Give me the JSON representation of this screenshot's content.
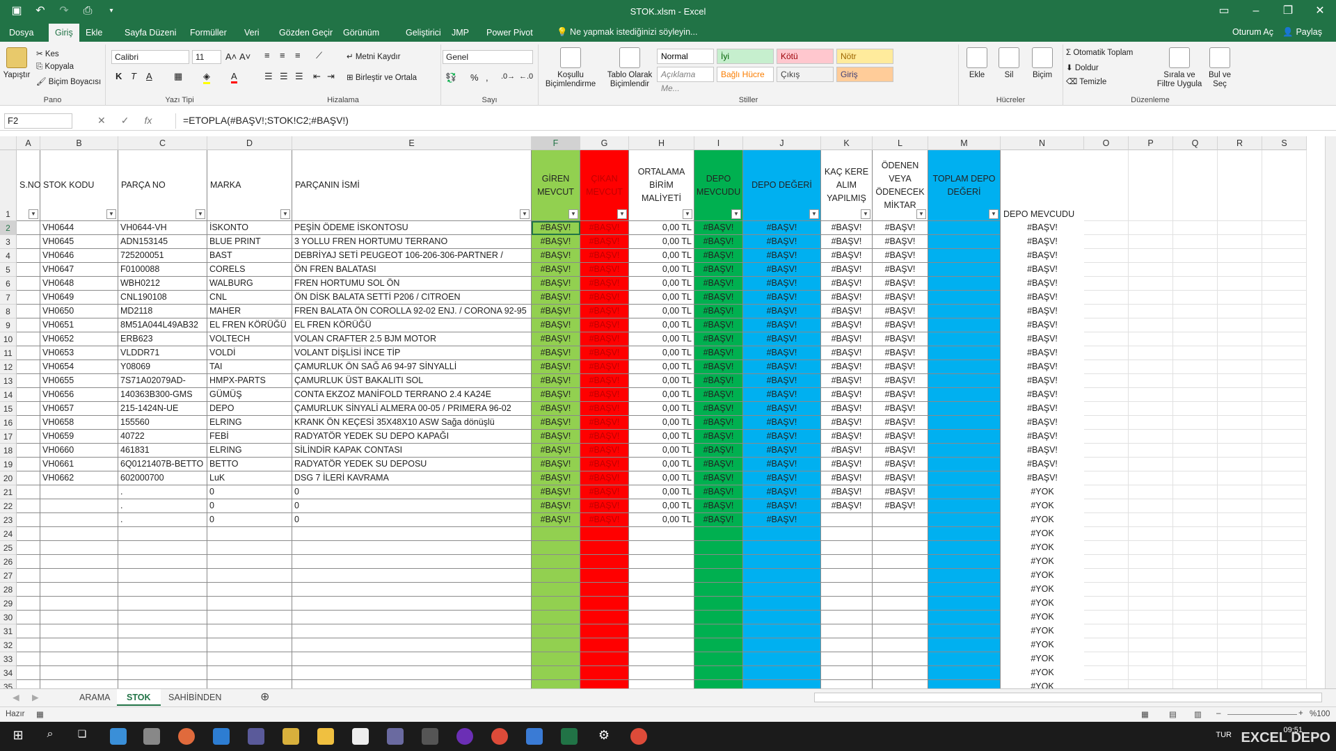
{
  "window": {
    "title": "STOK.xlsm - Excel"
  },
  "ribbon_tabs": [
    "Dosya",
    "Giriş",
    "Ekle",
    "Sayfa Düzeni",
    "Formüller",
    "Veri",
    "Gözden Geçir",
    "Görünüm",
    "Geliştirici",
    "JMP",
    "Power Pivot"
  ],
  "active_tab": "Giriş",
  "tell_me": "Ne yapmak istediğinizi söyleyin...",
  "account": {
    "signin": "Oturum Aç",
    "share": "Paylaş"
  },
  "ribbon": {
    "pano": {
      "paste": "Yapıştır",
      "cut": "Kes",
      "copy": "Kopyala",
      "format_painter": "Biçim Boyacısı",
      "label": "Pano"
    },
    "font": {
      "name": "Calibri",
      "size": "11",
      "label": "Yazı Tipi",
      "bold": "K",
      "italic": "T",
      "underline": "A"
    },
    "align": {
      "wrap": "Metni Kaydır",
      "merge": "Birleştir ve Ortala",
      "label": "Hizalama"
    },
    "number": {
      "format": "Genel",
      "percent": "%",
      "label": "Sayı"
    },
    "styles": {
      "cond": "Koşullu Biçimlendirme",
      "table": "Tablo Olarak Biçimlendir",
      "cells": [
        {
          "text": "Normal",
          "bg": "#ffffff",
          "fg": "#000000"
        },
        {
          "text": "İyi",
          "bg": "#c6efce",
          "fg": "#006100"
        },
        {
          "text": "Kötü",
          "bg": "#ffc7ce",
          "fg": "#9c0006"
        },
        {
          "text": "Nötr",
          "bg": "#ffeb9c",
          "fg": "#9c6500"
        },
        {
          "text": "Açıklama Me...",
          "bg": "#ffffff",
          "fg": "#7f7f7f"
        },
        {
          "text": "Bağlı Hücre",
          "bg": "#ffffff",
          "fg": "#fa7d00"
        },
        {
          "text": "Çıkış",
          "bg": "#f2f2f2",
          "fg": "#3f3f3f"
        },
        {
          "text": "Giriş",
          "bg": "#ffcc99",
          "fg": "#3f3f76"
        }
      ],
      "label": "Stiller"
    },
    "cells_grp": {
      "insert": "Ekle",
      "delete": "Sil",
      "format": "Biçim",
      "label": "Hücreler"
    },
    "edit": {
      "autosum": "Otomatik Toplam",
      "fill": "Doldur",
      "clear": "Temizle",
      "sort": "Sırala ve Filtre Uygula",
      "find": "Bul ve Seç",
      "label": "Düzenleme"
    }
  },
  "formula_bar": {
    "name_box": "F2",
    "formula": "=ETOPLA(#BAŞV!;STOK!C2;#BAŞV!)",
    "fx": "fx"
  },
  "columns": [
    "A",
    "B",
    "C",
    "D",
    "E",
    "F",
    "G",
    "H",
    "I",
    "J",
    "K",
    "L",
    "M",
    "N",
    "O",
    "P",
    "Q",
    "R",
    "S"
  ],
  "headers": {
    "A": "S.NO",
    "B": "STOK KODU",
    "C": "PARÇA NO",
    "D": "MARKA",
    "E": "PARÇANIN İSMİ",
    "F": "GİREN MEVCUT",
    "G": "ÇIKAN MEVCUT",
    "H": "ORTALAMA BİRİM MALİYETİ",
    "I": "DEPO MEVCUDU",
    "J": "DEPO DEĞERİ",
    "K": "KAÇ KERE ALIM YAPILMIŞ",
    "L": "ÖDENEN VEYA ÖDENECEK MİKTAR",
    "M": "TOPLAM DEPO DEĞERİ",
    "N": "DEPO MEVCUDU"
  },
  "colors": {
    "F": "#92d050",
    "G": "#ff0000",
    "I": "#00b050",
    "J": "#00b0f0",
    "M": "#00b0f0",
    "accent": "#217346"
  },
  "rows": [
    {
      "b": "VH0644",
      "c": "VH0644-VH",
      "d": "İSKONTO",
      "e": "PEŞİN ÖDEME İSKONTOSU"
    },
    {
      "b": "VH0645",
      "c": "ADN153145",
      "d": "BLUE PRINT",
      "e": "3 YOLLU FREN HORTUMU TERRANO"
    },
    {
      "b": "VH0646",
      "c": "725200051",
      "d": "BAST",
      "e": "DEBRİYAJ SETİ PEUGEOT 106-206-306-PARTNER /"
    },
    {
      "b": "VH0647",
      "c": "F0100088",
      "d": "CORELS",
      "e": "ÖN FREN BALATASI"
    },
    {
      "b": "VH0648",
      "c": "WBH0212",
      "d": "WALBURG",
      "e": "FREN HORTUMU SOL ÖN"
    },
    {
      "b": "VH0649",
      "c": "CNL190108",
      "d": "CNL",
      "e": "ÖN DİSK BALATA SETTİ P206 / CITROEN"
    },
    {
      "b": "VH0650",
      "c": "MD2118",
      "d": "MAHER",
      "e": "FREN BALATA ÖN COROLLA 92-02 ENJ. / CORONA 92-95"
    },
    {
      "b": "VH0651",
      "c": "8M51A044L49AB32",
      "d": "EL FREN KÖRÜĞÜ",
      "e": "EL FREN KÖRÜĞÜ"
    },
    {
      "b": "VH0652",
      "c": "ERB623",
      "d": "VOLTECH",
      "e": "VOLAN CRAFTER 2.5 BJM MOTOR"
    },
    {
      "b": "VH0653",
      "c": "VLDDR71",
      "d": "VOLDİ",
      "e": "VOLANT DİŞLİSİ İNCE TİP"
    },
    {
      "b": "VH0654",
      "c": "Y08069",
      "d": "TAI",
      "e": "ÇAMURLUK ÖN SAĞ A6 94-97 SİNYALLİ"
    },
    {
      "b": "VH0655",
      "c": "7S71A02079AD-",
      "d": "HMPX-PARTS",
      "e": "ÇAMURLUK ÜST BAKALITI SOL"
    },
    {
      "b": "VH0656",
      "c": "140363B300-GMS",
      "d": "GÜMÜŞ",
      "e": "CONTA EKZOZ MANİFOLD  TERRANO 2.4 KA24E"
    },
    {
      "b": "VH0657",
      "c": "215-1424N-UE",
      "d": "DEPO",
      "e": "ÇAMURLUK SİNYALİ ALMERA 00-05 / PRIMERA 96-02"
    },
    {
      "b": "VH0658",
      "c": "155560",
      "d": "ELRING",
      "e": "KRANK ÖN KEÇESİ 35X48X10 ASW Sağa dönüşlü"
    },
    {
      "b": "VH0659",
      "c": "40722",
      "d": "FEBİ",
      "e": "RADYATÖR YEDEK SU DEPO KAPAĞI"
    },
    {
      "b": "VH0660",
      "c": "461831",
      "d": "ELRING",
      "e": "SİLİNDİR KAPAK CONTASI"
    },
    {
      "b": "VH0661",
      "c": "6Q0121407B-BETTO",
      "d": "BETTO",
      "e": "RADYATÖR YEDEK SU DEPOSU"
    },
    {
      "b": "VH0662",
      "c": "602000700",
      "d": "LuK",
      "e": "DSG 7 İLERİ KAVRAMA"
    },
    {
      "b": "",
      "c": ".",
      "d": "0",
      "e": "0"
    },
    {
      "b": "",
      "c": ".",
      "d": "0",
      "e": "0"
    },
    {
      "b": "",
      "c": ".",
      "d": "0",
      "e": "0"
    }
  ],
  "error_value": "#BAŞV!",
  "cost_value": "0,00 TL",
  "na_value": "#YOK",
  "row_numbers": [
    "1",
    "2",
    "3",
    "4",
    "5",
    "6",
    "7",
    "8",
    "9",
    "10",
    "11",
    "12",
    "13",
    "14",
    "15",
    "16",
    "17",
    "18",
    "19",
    "20",
    "21",
    "22",
    "23",
    "24",
    "25",
    "26",
    "27",
    "28",
    "29",
    "30",
    "31",
    "32",
    "33",
    "34",
    "35"
  ],
  "sheets": [
    "ARAMA",
    "STOK",
    "SAHİBİNDEN"
  ],
  "active_sheet": "STOK",
  "status": {
    "ready": "Hazır",
    "zoom": "%100"
  },
  "taskbar": {
    "time": "09:51",
    "lang": "TUR",
    "watermark": "EXCEL DEPO"
  }
}
